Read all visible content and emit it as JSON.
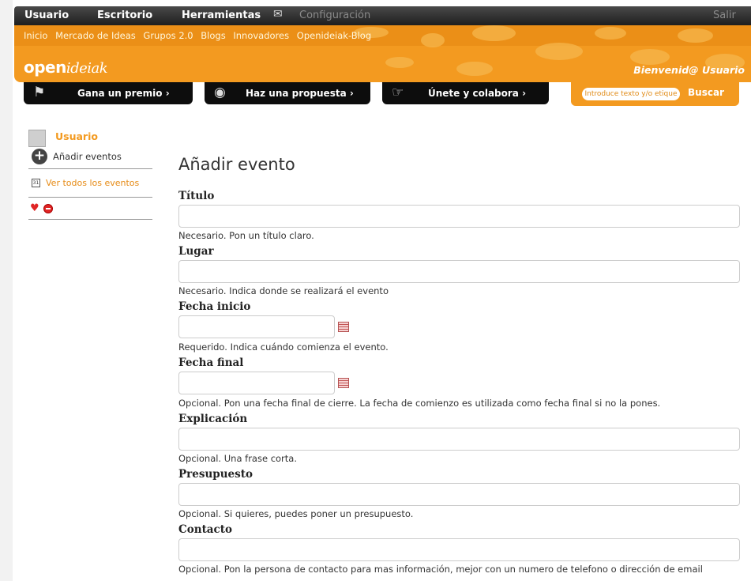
{
  "topbar": {
    "items": [
      "Usuario",
      "Escritorio",
      "Herramientas"
    ],
    "config": "Configuración",
    "logout": "Salir"
  },
  "nav": {
    "links": [
      "Inicio",
      "Mercado de Ideas",
      "Grupos 2.0",
      "Blogs",
      "Innovadores",
      "Openideiak-Blog"
    ]
  },
  "logo": {
    "bold": "open",
    "thin": "ideiak"
  },
  "welcome": "Bienvenid@ Usuario",
  "actions": [
    {
      "label": "Gana un premio  ›",
      "icon": "checkered-flag-icon"
    },
    {
      "label": "Haz una propuesta  ›",
      "icon": "target-icon"
    },
    {
      "label": "Únete y colabora  ›",
      "icon": "pointing-hand-icon"
    }
  ],
  "search": {
    "placeholder": "Introduce texto y/o etique",
    "button": "Buscar"
  },
  "sidebar": {
    "user": "Usuario",
    "add_events": "Añadir eventos",
    "view_all": "Ver todos los eventos"
  },
  "form": {
    "title": "Añadir evento",
    "fields": [
      {
        "label": "Título",
        "help": "Necesario. Pon un título claro."
      },
      {
        "label": "Lugar",
        "help": "Necesario. Indica donde se realizará el evento"
      },
      {
        "label": "Fecha inicio",
        "help": "Requerido. Indica cuándo comienza el evento."
      },
      {
        "label": "Fecha final",
        "help": "Opcional. Pon una fecha final de cierre. La fecha de comienzo es utilizada como fecha final si no la pones."
      },
      {
        "label": "Explicación",
        "help": "Opcional. Una frase corta."
      },
      {
        "label": "Presupuesto",
        "help": "Opcional. Si quieres, puedes poner un presupuesto."
      },
      {
        "label": "Contacto",
        "help": "Opcional. Pon la persona de contacto para mas información, mejor con un numero de telefono o dirección de email"
      }
    ]
  },
  "colors": {
    "accent": "#f39a20",
    "dark": "#1e1e1e",
    "link": "#e68a14"
  }
}
